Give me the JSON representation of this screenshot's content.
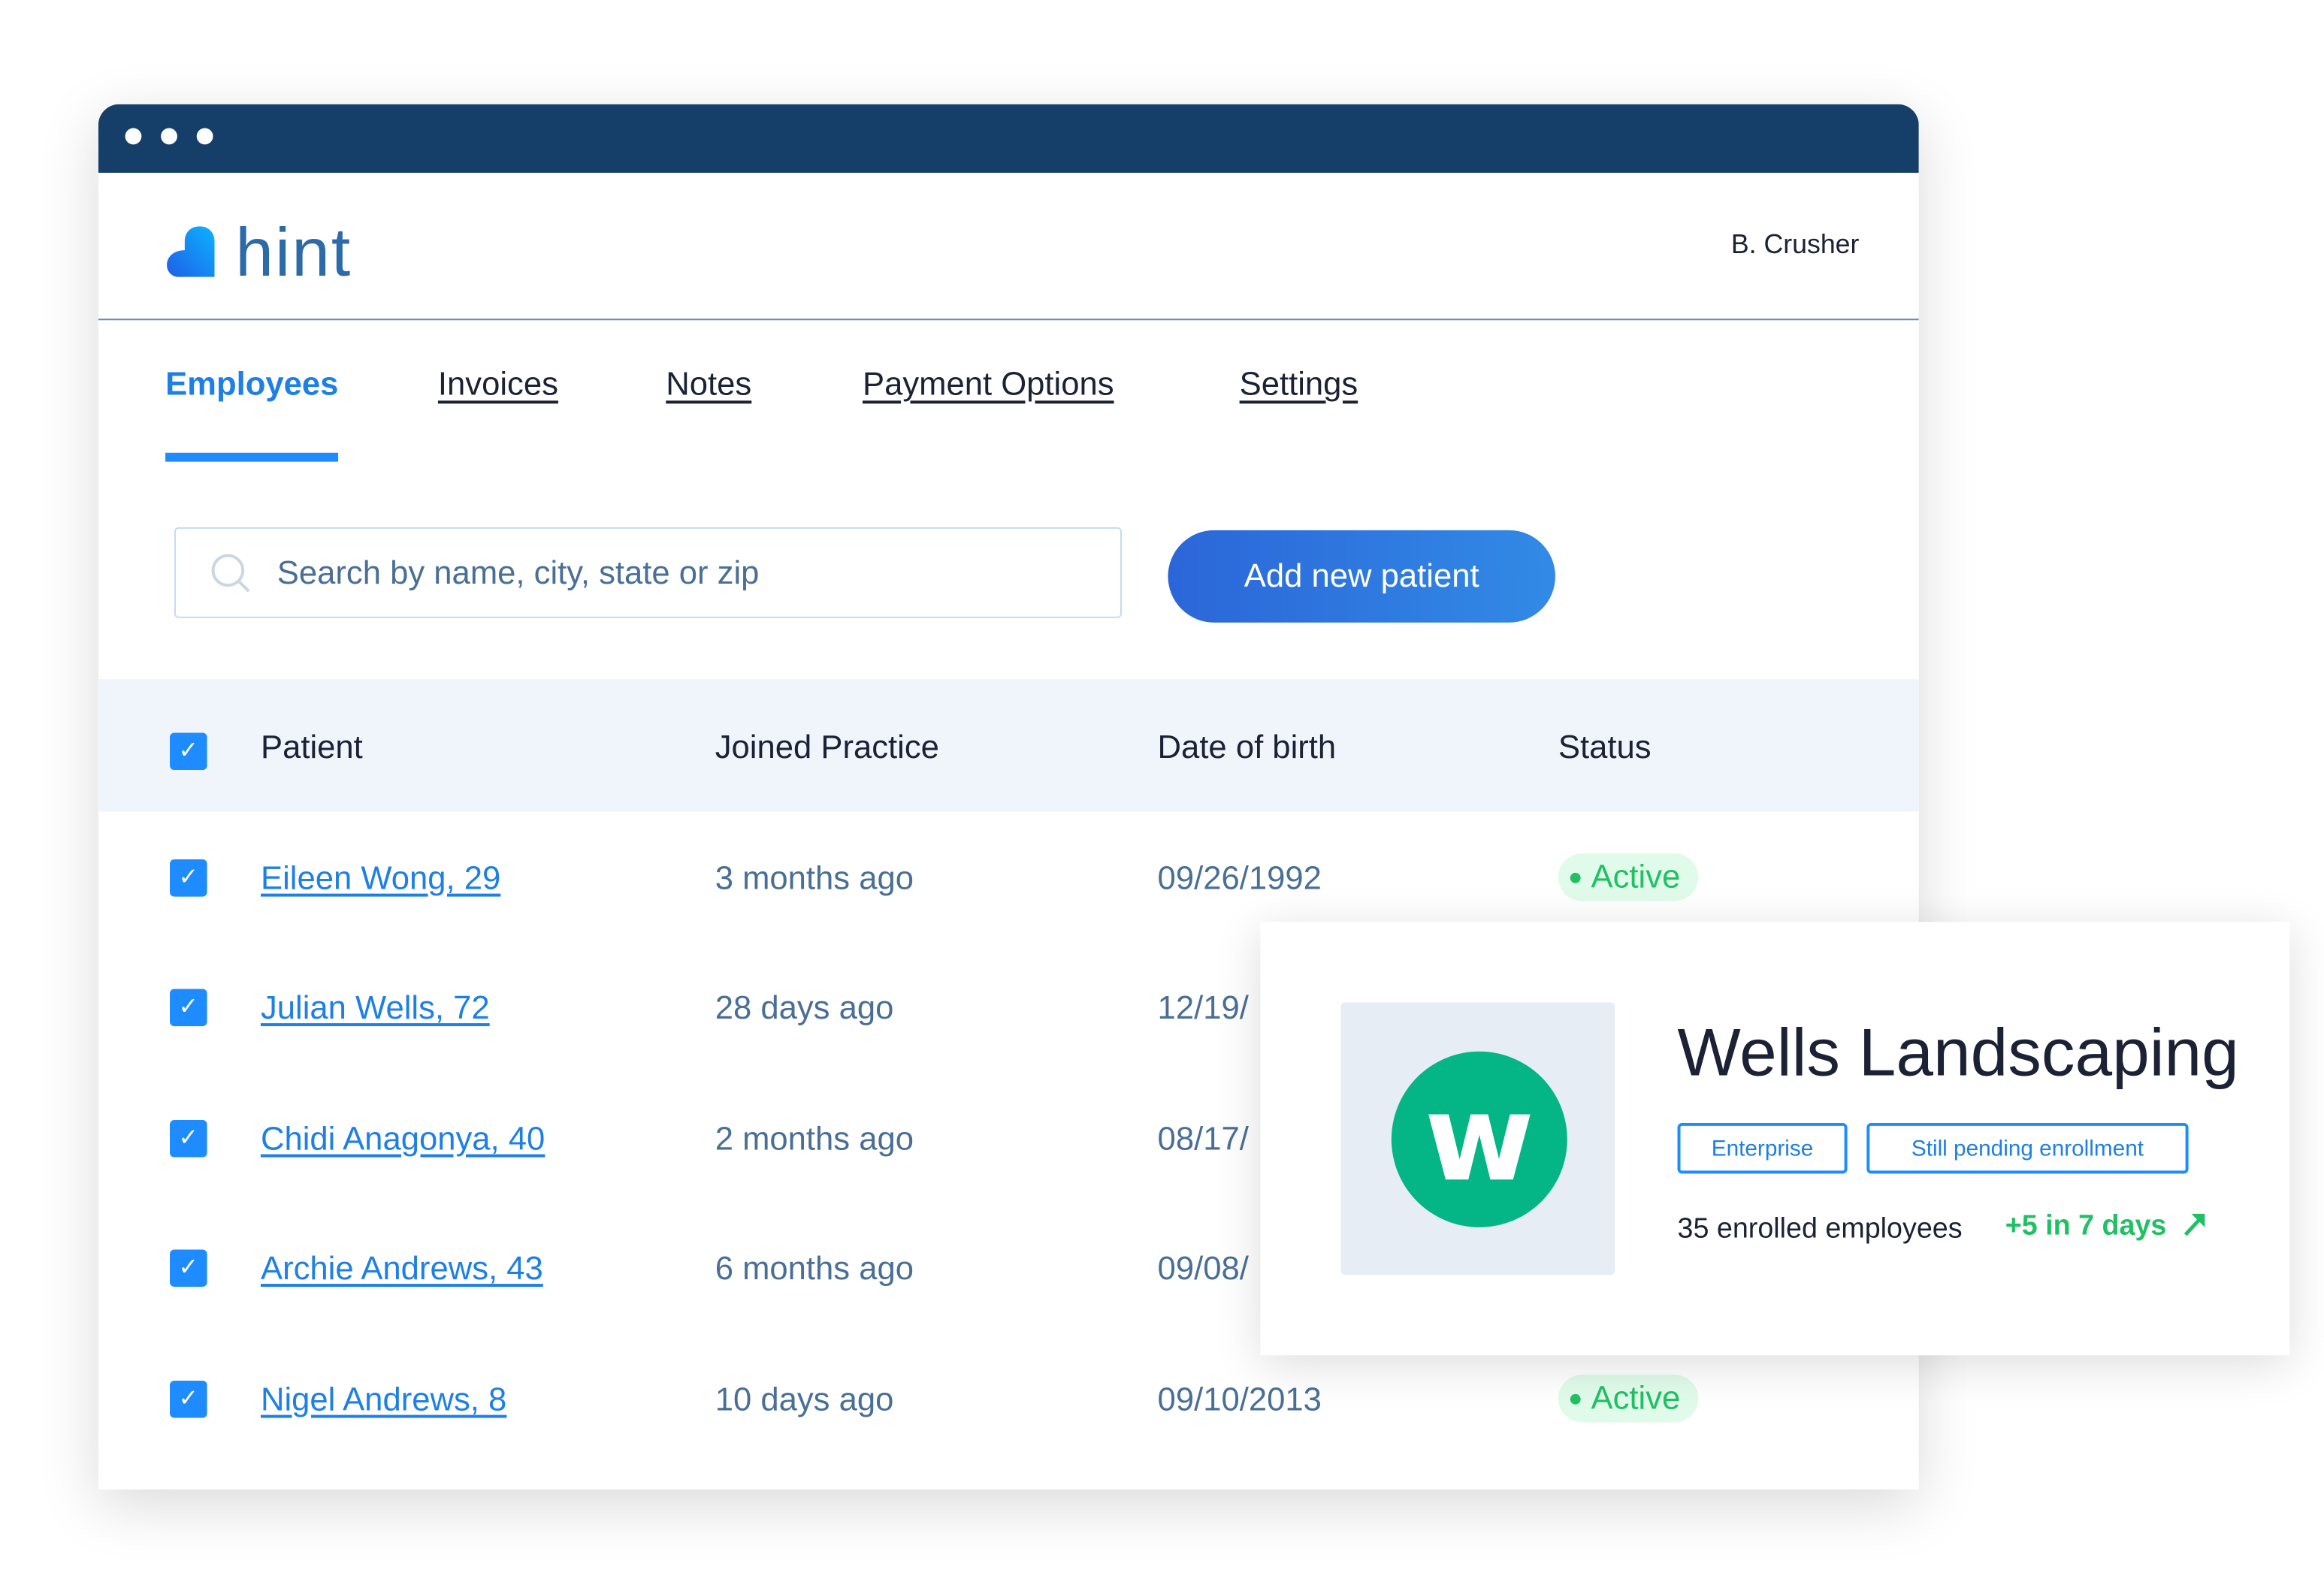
{
  "app": {
    "logo_text": "hint",
    "user": "B. Crusher",
    "brand_color": "#1e8cff",
    "titlebar_color": "#153e69"
  },
  "nav": {
    "tabs": [
      {
        "label": "Employees",
        "active": true
      },
      {
        "label": "Invoices"
      },
      {
        "label": "Notes"
      },
      {
        "label": "Payment Options"
      },
      {
        "label": "Settings"
      }
    ]
  },
  "search": {
    "placeholder": "Search by name, city, state or zip",
    "icon": "search-icon"
  },
  "add_button": {
    "label": "Add new patient"
  },
  "table": {
    "header": {
      "checked": true,
      "columns": [
        "Patient",
        "Joined Practice",
        "Date of birth",
        "Status"
      ]
    },
    "rows": [
      {
        "checked": true,
        "patient": "Eileen Wong, 29",
        "joined": "3 months ago",
        "dob": "09/26/1992",
        "status": "Active"
      },
      {
        "checked": true,
        "patient": "Julian Wells, 72",
        "joined": "28 days ago",
        "dob": "12/19/"
      },
      {
        "checked": true,
        "patient": "Chidi Anagonya, 40",
        "joined": "2 months ago",
        "dob": "08/17/"
      },
      {
        "checked": true,
        "patient": "Archie Andrews, 43",
        "joined": "6 months ago",
        "dob": "09/08/"
      },
      {
        "checked": true,
        "patient": "Nigel Andrews, 8",
        "joined": "10 days ago",
        "dob": "09/10/2013",
        "status": "Active"
      }
    ]
  },
  "card": {
    "logo_letter": "w",
    "logo_color": "#04b585",
    "title": "Wells Landscaping",
    "tags": [
      "Enterprise",
      "Still pending enrollment"
    ],
    "enrolled": "35 enrolled employees",
    "growth": "+5 in 7 days",
    "growth_icon": "arrow-up-right-icon",
    "status_color": "#22c064"
  }
}
